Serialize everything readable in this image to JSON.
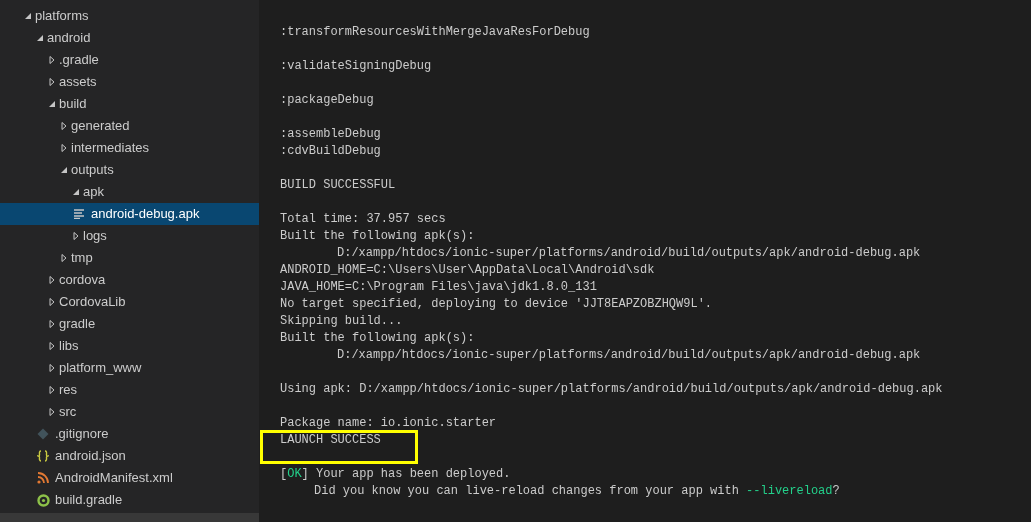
{
  "explorer": {
    "tree": [
      {
        "label": "platforms",
        "kind": "folder",
        "expanded": true,
        "selected": false,
        "children": [
          {
            "label": "android",
            "kind": "folder",
            "expanded": true,
            "selected": false,
            "children": [
              {
                "label": ".gradle",
                "kind": "folder",
                "expanded": false,
                "selected": false
              },
              {
                "label": "assets",
                "kind": "folder",
                "expanded": false,
                "selected": false
              },
              {
                "label": "build",
                "kind": "folder",
                "expanded": true,
                "selected": false,
                "children": [
                  {
                    "label": "generated",
                    "kind": "folder",
                    "expanded": false,
                    "selected": false
                  },
                  {
                    "label": "intermediates",
                    "kind": "folder",
                    "expanded": false,
                    "selected": false
                  },
                  {
                    "label": "outputs",
                    "kind": "folder",
                    "expanded": true,
                    "selected": false,
                    "children": [
                      {
                        "label": "apk",
                        "kind": "folder",
                        "expanded": true,
                        "selected": false,
                        "children": [
                          {
                            "label": "android-debug.apk",
                            "kind": "text-file",
                            "selected": true
                          }
                        ]
                      },
                      {
                        "label": "logs",
                        "kind": "folder",
                        "expanded": false,
                        "selected": false
                      }
                    ]
                  },
                  {
                    "label": "tmp",
                    "kind": "folder",
                    "expanded": false,
                    "selected": false
                  }
                ]
              },
              {
                "label": "cordova",
                "kind": "folder",
                "expanded": false,
                "selected": false
              },
              {
                "label": "CordovaLib",
                "kind": "folder",
                "expanded": false,
                "selected": false
              },
              {
                "label": "gradle",
                "kind": "folder",
                "expanded": false,
                "selected": false
              },
              {
                "label": "libs",
                "kind": "folder",
                "expanded": false,
                "selected": false
              },
              {
                "label": "platform_www",
                "kind": "folder",
                "expanded": false,
                "selected": false
              },
              {
                "label": "res",
                "kind": "folder",
                "expanded": false,
                "selected": false
              },
              {
                "label": "src",
                "kind": "folder",
                "expanded": false,
                "selected": false
              },
              {
                "label": ".gitignore",
                "kind": "git-file",
                "selected": false
              },
              {
                "label": "android.json",
                "kind": "json-file",
                "selected": false
              },
              {
                "label": "AndroidManifest.xml",
                "kind": "xml-file",
                "selected": false
              },
              {
                "label": "build.gradle",
                "kind": "gradle-file",
                "selected": false
              }
            ]
          }
        ]
      }
    ]
  },
  "terminal": {
    "blocks": [
      [
        {
          "indent": false,
          "segments": [
            {
              "text": ":transformResourcesWithMergeJavaResForDebug",
              "kind": "plain"
            }
          ]
        }
      ],
      [
        {
          "indent": false,
          "segments": [
            {
              "text": ":validateSigningDebug",
              "kind": "plain"
            }
          ]
        }
      ],
      [
        {
          "indent": false,
          "segments": [
            {
              "text": ":packageDebug",
              "kind": "plain"
            }
          ]
        }
      ],
      [
        {
          "indent": false,
          "segments": [
            {
              "text": ":assembleDebug",
              "kind": "plain"
            }
          ]
        },
        {
          "indent": false,
          "segments": [
            {
              "text": ":cdvBuildDebug",
              "kind": "plain"
            }
          ]
        }
      ],
      [
        {
          "indent": false,
          "segments": [
            {
              "text": "BUILD SUCCESSFUL",
              "kind": "plain"
            }
          ]
        }
      ],
      [
        {
          "indent": false,
          "segments": [
            {
              "text": "Total time: 37.957 secs",
              "kind": "plain"
            }
          ]
        },
        {
          "indent": false,
          "segments": [
            {
              "text": "Built the following apk(s):",
              "kind": "plain"
            }
          ]
        },
        {
          "indent": true,
          "segments": [
            {
              "text": "D:/xampp/htdocs/ionic-super/platforms/android/build/outputs/apk/android-debug.apk",
              "kind": "plain"
            }
          ]
        },
        {
          "indent": false,
          "segments": [
            {
              "text": "ANDROID_HOME=C:\\Users\\User\\AppData\\Local\\Android\\sdk",
              "kind": "plain"
            }
          ]
        },
        {
          "indent": false,
          "segments": [
            {
              "text": "JAVA_HOME=C:\\Program Files\\java\\jdk1.8.0_131",
              "kind": "plain"
            }
          ]
        },
        {
          "indent": false,
          "segments": [
            {
              "text": "No target specified, deploying to device 'JJT8EAPZOBZHQW9L'.",
              "kind": "plain"
            }
          ]
        },
        {
          "indent": false,
          "segments": [
            {
              "text": "Skipping build...",
              "kind": "plain"
            }
          ]
        },
        {
          "indent": false,
          "segments": [
            {
              "text": "Built the following apk(s):",
              "kind": "plain"
            }
          ]
        },
        {
          "indent": true,
          "segments": [
            {
              "text": "D:/xampp/htdocs/ionic-super/platforms/android/build/outputs/apk/android-debug.apk",
              "kind": "plain"
            }
          ]
        }
      ],
      [
        {
          "indent": false,
          "segments": [
            {
              "text": "Using apk: D:/xampp/htdocs/ionic-super/platforms/android/build/outputs/apk/android-debug.apk",
              "kind": "plain"
            }
          ]
        }
      ],
      [
        {
          "indent": false,
          "segments": [
            {
              "text": "Package name: io.ionic.starter",
              "kind": "plain"
            }
          ]
        },
        {
          "indent": false,
          "segments": [
            {
              "text": "LAUNCH SUCCESS",
              "kind": "plain"
            }
          ]
        }
      ],
      [
        {
          "indent": false,
          "segments": [
            {
              "text": "[",
              "kind": "plain"
            },
            {
              "text": "OK",
              "kind": "green"
            },
            {
              "text": "] Your app has been deployed.",
              "kind": "plain"
            }
          ]
        },
        {
          "indent": false,
          "continuation": true,
          "segments": [
            {
              "text": "Did you know you can live-reload changes from your app with ",
              "kind": "plain"
            },
            {
              "text": "--livereload",
              "kind": "green"
            },
            {
              "text": "?",
              "kind": "plain"
            }
          ]
        }
      ]
    ]
  }
}
